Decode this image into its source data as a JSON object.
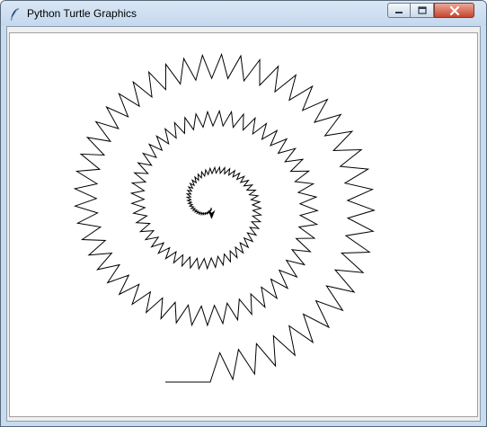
{
  "window": {
    "title": "Python Turtle Graphics",
    "controls": {
      "minimize_icon": "minimize-icon",
      "maximize_icon": "maximize-icon",
      "close_icon": "close-icon"
    }
  },
  "canvas": {
    "background": "#ffffff",
    "pen_color": "#000000",
    "drawing": "zigzag spiral",
    "turtle_icon": "turtle-arrow-icon"
  }
}
